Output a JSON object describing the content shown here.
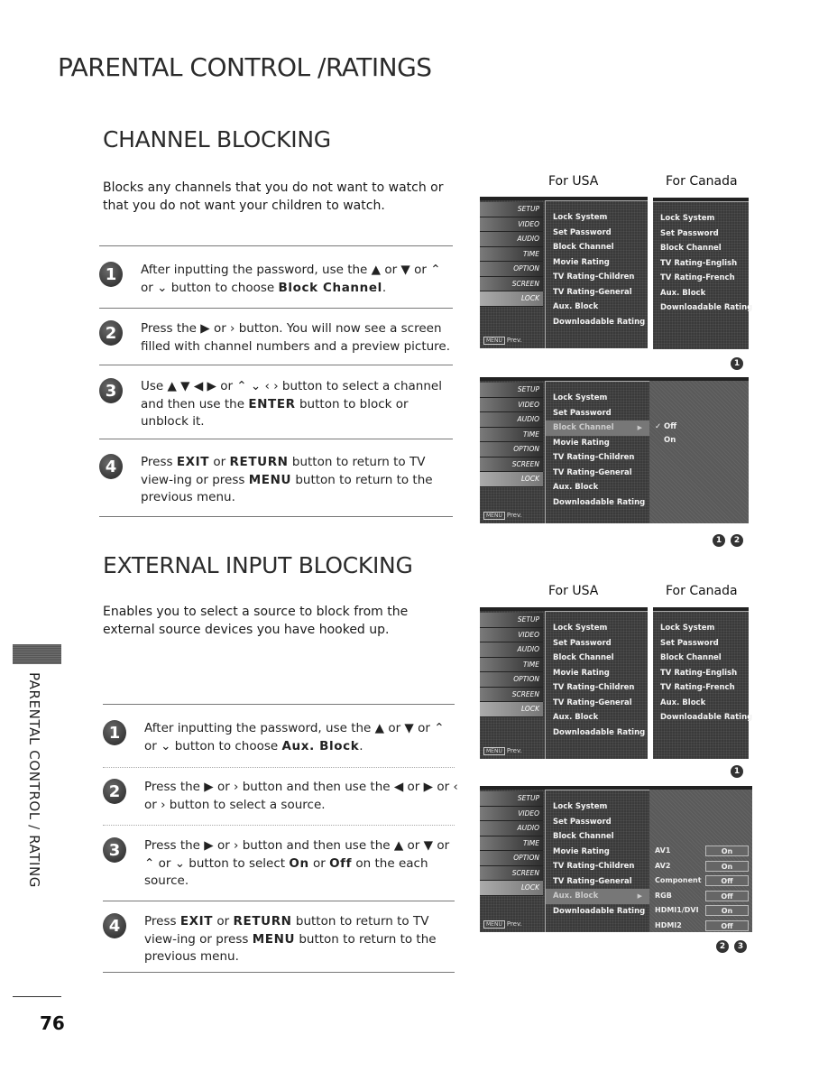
{
  "page": {
    "title": "PARENTAL CONTROL /RATINGS",
    "side_label": "PARENTAL CONTROL / RATING",
    "page_number": "76"
  },
  "channel_blocking": {
    "title": "CHANNEL BLOCKING",
    "intro": "Blocks any channels that you do not want to watch or that you do not want your children to watch.",
    "steps": [
      {
        "num": "1",
        "html": "After inputting the password, use the &#9650; or &#9660;  or  &#8963; or &#8964;  button to choose <b>Block Channel</b>."
      },
      {
        "num": "2",
        "html": "Press the &#9654;  or  &#8250;  button. You will now see a screen filled with channel numbers and a preview picture."
      },
      {
        "num": "3",
        "html": "Use &#9650; &#9660; &#9664; &#9654; or &#8963; &#8964; &#8249; &#8250;  button to select a channel and then use the <b>ENTER</b> button to block or unblock it."
      },
      {
        "num": "4",
        "html": "Press <b>EXIT</b> or <b>RETURN</b> button to return to TV view-ing or press <b>MENU</b> button to return to the previous menu."
      }
    ],
    "figure1": {
      "label_usa": "For USA",
      "label_canada": "For Canada",
      "badges": [
        "1"
      ]
    },
    "figure2": {
      "badges": [
        "1",
        "2"
      ],
      "highlighted": "Block Channel",
      "options": [
        {
          "label": "Off",
          "checked": true
        },
        {
          "label": "On",
          "checked": false
        }
      ]
    }
  },
  "external_input_blocking": {
    "title": "EXTERNAL INPUT BLOCKING",
    "intro": "Enables you to select a source to block from the external source devices you have hooked up.",
    "steps": [
      {
        "num": "1",
        "html": "After inputting the password, use the &#9650; or &#9660;  or  &#8963; or &#8964;  button to choose <b>Aux. Block</b>."
      },
      {
        "num": "2",
        "html": "Press the &#9654;  or  &#8250;  button and then use the &#9664; or &#9654; or  &#8249;  or  &#8250;  button  to select a source."
      },
      {
        "num": "3",
        "html": "Press the &#9654;  or  &#8250;  button and then use the &#9650; or &#9660; or  &#8963;  or  &#8964;   button to select <b>On</b> or <b>Off</b> on the each source."
      },
      {
        "num": "4",
        "html": "Press <b>EXIT</b> or <b>RETURN</b> button to return to TV view-ing or press <b>MENU</b> button to return to the previous menu."
      }
    ],
    "figure1": {
      "label_usa": "For USA",
      "label_canada": "For Canada",
      "badges": [
        "1"
      ]
    },
    "figure2": {
      "badges": [
        "2",
        "3"
      ],
      "highlighted": "Aux. Block",
      "sources": [
        {
          "name": "AV1",
          "value": "On"
        },
        {
          "name": "AV2",
          "value": "On"
        },
        {
          "name": "Component",
          "value": "Off"
        },
        {
          "name": "RGB",
          "value": "Off"
        },
        {
          "name": "HDMI1/DVI",
          "value": "On"
        },
        {
          "name": "HDMI2",
          "value": "Off"
        }
      ]
    }
  },
  "osd": {
    "tabs": [
      "SETUP",
      "VIDEO",
      "AUDIO",
      "TIME",
      "OPTION",
      "SCREEN",
      "LOCK"
    ],
    "active_tab": "LOCK",
    "prev_key": "MENU",
    "prev_label": "Prev.",
    "usa_items": [
      "Lock System",
      "Set Password",
      "Block Channel",
      "Movie Rating",
      "TV Rating-Children",
      "TV Rating-General",
      "Aux. Block",
      "Downloadable Rating"
    ],
    "canada_items": [
      "Lock System",
      "Set Password",
      "Block Channel",
      "TV Rating-English",
      "TV Rating-French",
      "Aux. Block",
      "Downloadable Rating"
    ]
  }
}
